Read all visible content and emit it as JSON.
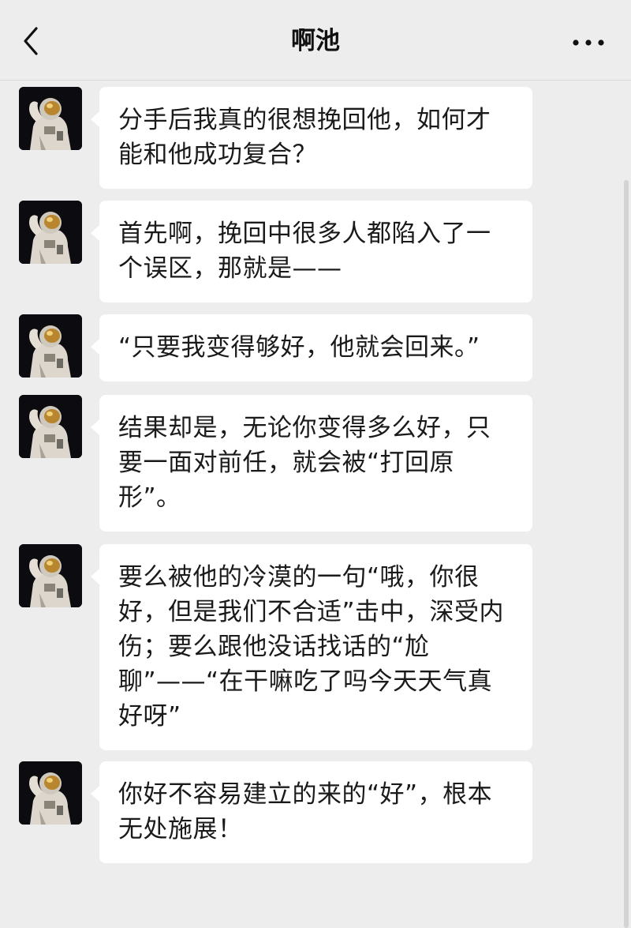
{
  "header": {
    "title": "啊池",
    "back_icon": "chevron-left-icon",
    "more_icon": "more-dots-icon"
  },
  "messages": [
    {
      "avatar_icon": "astronaut-avatar",
      "text": "分手后我真的很想挽回他，如何才能和他成功复合？"
    },
    {
      "avatar_icon": "astronaut-avatar",
      "text": "首先啊，挽回中很多人都陷入了一个误区，那就是——"
    },
    {
      "avatar_icon": "astronaut-avatar",
      "text": "“只要我变得够好，他就会回来。”"
    },
    {
      "avatar_icon": "astronaut-avatar",
      "text": "结果却是，无论你变得多么好，只要一面对前任，就会被“打回原形”。"
    },
    {
      "avatar_icon": "astronaut-avatar",
      "text": "要么被他的冷漠的一句“哦，你很好，但是我们不合适”击中，深受内伤；要么跟他没话找话的“尬聊”——“在干嘛吃了吗今天天气真好呀”"
    },
    {
      "avatar_icon": "astronaut-avatar",
      "text": "你好不容易建立的来的“好”，根本无处施展！"
    }
  ],
  "colors": {
    "background": "#ededed",
    "bubble": "#ffffff",
    "text": "#1a1a1a"
  }
}
